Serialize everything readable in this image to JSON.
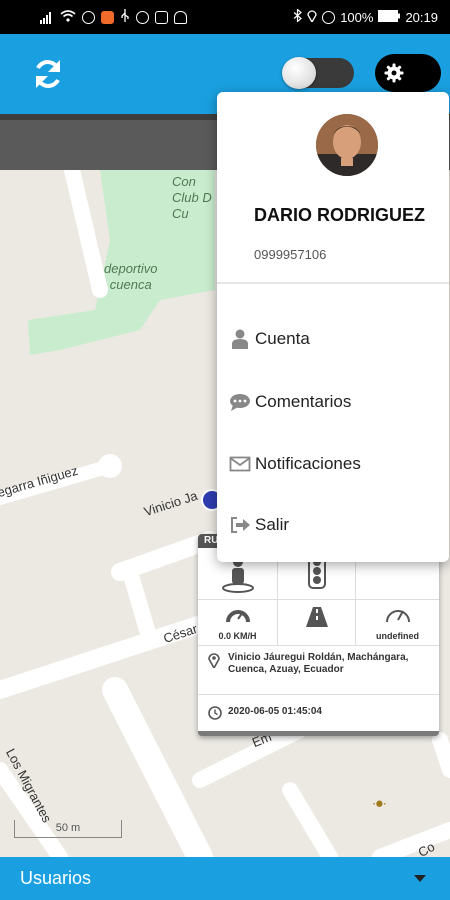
{
  "status_bar": {
    "battery": "100%",
    "time": "20:19",
    "icons": [
      "signal-icon",
      "wifi-icon",
      "alarm-icon",
      "app-icon",
      "usb-icon",
      "whatsapp-icon",
      "gallery-icon",
      "vpn-icon",
      "bluetooth-icon",
      "location-icon",
      "mute-icon",
      "battery-icon"
    ]
  },
  "toolbar": {
    "refresh_icon": "refresh-icon",
    "settings_icon": "gear-icon",
    "toggle_state": "off"
  },
  "map": {
    "labels": {
      "club": "Con\nClub D\nCu",
      "park": "deportivo\ncuenca"
    },
    "streets": {
      "segarra": "egarra Iñiguez",
      "vinicio": "Vinicio Ja",
      "cesar": "César",
      "em": "Em",
      "migrantes": "Los Migrantes",
      "co": "Co"
    },
    "scale": "50 m"
  },
  "info_card": {
    "header": "RU",
    "speed": "0.0 KM/H",
    "odometer": "undefined",
    "address": "Vinicio Jáuregui Roldán, Machángara, Cuenca, Azuay, Ecuador",
    "timestamp": "2020-06-05 01:45:04"
  },
  "profile": {
    "name": "DARIO RODRIGUEZ",
    "phone": "0999957106"
  },
  "menu": {
    "items": [
      {
        "label": "Cuenta",
        "icon": "user-icon"
      },
      {
        "label": "Comentarios",
        "icon": "comment-icon"
      },
      {
        "label": "Notificaciones",
        "icon": "envelope-icon"
      },
      {
        "label": "Salir",
        "icon": "sign-out-icon"
      }
    ]
  },
  "bottom_bar": {
    "label": "Usuarios",
    "icon": "caret-down-icon"
  },
  "colors": {
    "brand": "#1aa0e0",
    "park": "#c9ecce",
    "map_bg": "#ece9e3"
  }
}
